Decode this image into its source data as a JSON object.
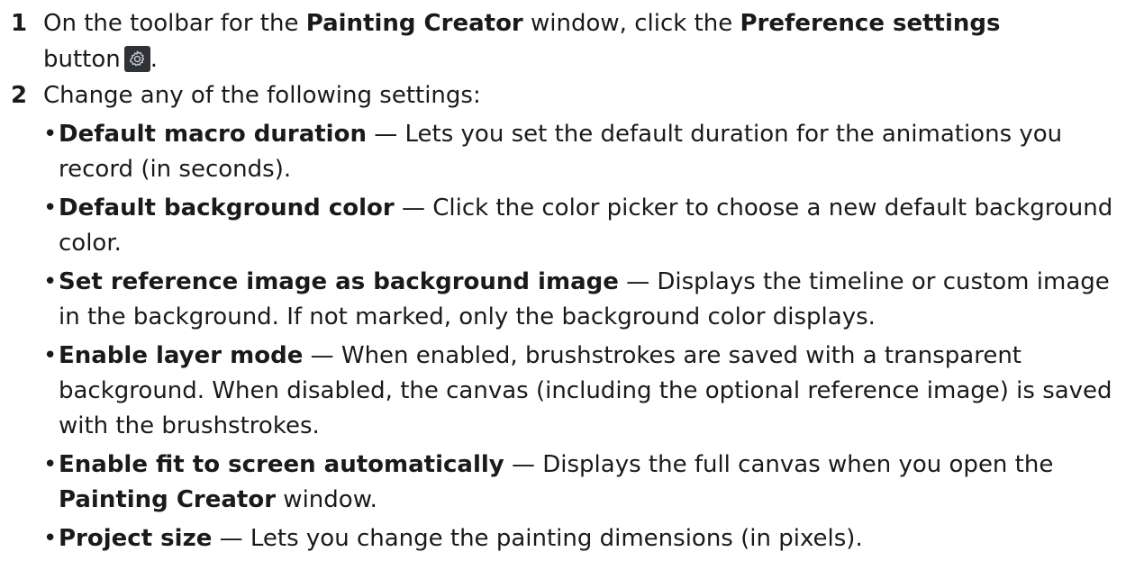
{
  "step1": {
    "number": "1",
    "text_before": "On the toolbar for the ",
    "app_name": "Painting Creator",
    "text_middle": " window, click the ",
    "button_name": "Preference settings",
    "text_after_bold": " button",
    "text_end": ".",
    "icon": "gear-icon"
  },
  "step2": {
    "number": "2",
    "intro": "Change any of the following settings:",
    "bullet_symbol": "•",
    "items": [
      {
        "term": "Default macro duration",
        "desc": " — Lets you set the default duration for the animations you record (in seconds)."
      },
      {
        "term": "Default background color",
        "desc": " — Click the color picker to choose a new default background color."
      },
      {
        "term": "Set reference image as background image",
        "desc": " — Displays the timeline or custom image in the background. If not marked, only the background color displays."
      },
      {
        "term": "Enable layer mode",
        "desc": " — When enabled, brushstrokes are saved with a transparent background. When disabled, the canvas (including the optional reference image) is saved with the brushstrokes."
      },
      {
        "term": "Enable fit to screen automatically",
        "desc": " — Displays the full canvas when you open the ",
        "desc_bold": "Painting Creator",
        "desc_end": " window."
      },
      {
        "term": "Project size",
        "desc": " — Lets you change the painting dimensions (in pixels)."
      }
    ]
  }
}
